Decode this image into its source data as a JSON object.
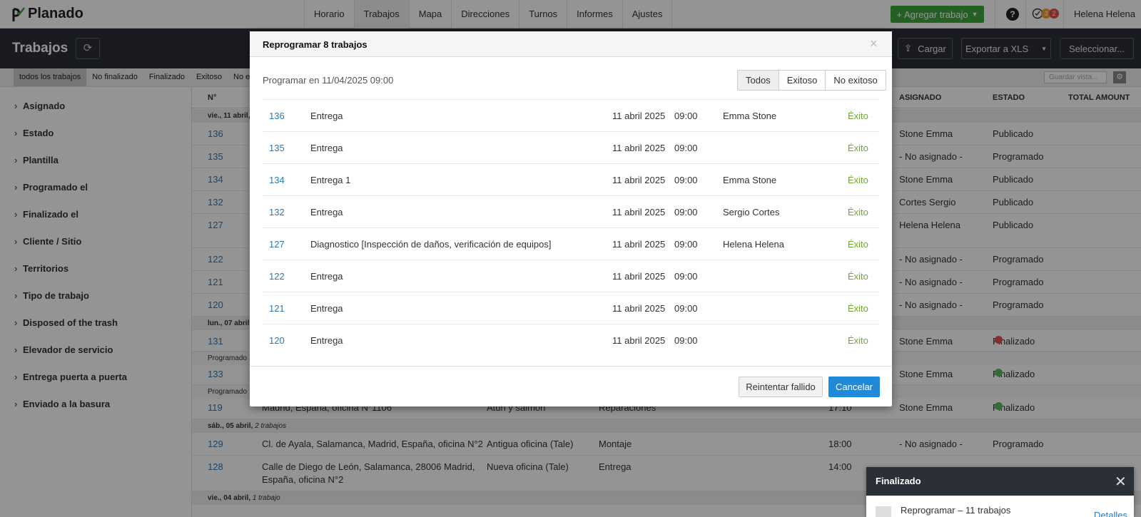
{
  "app": {
    "logo_text": "Planado"
  },
  "nav": {
    "items": [
      "Horario",
      "Trabajos",
      "Mapa",
      "Direcciones",
      "Turnos",
      "Informes",
      "Ajustes"
    ],
    "add_button": "+ Agregar trabajo",
    "help": "?",
    "badges": [
      "3",
      "2"
    ],
    "user": "Helena Helena"
  },
  "header": {
    "title": "Trabajos",
    "upload": "Cargar",
    "export": "Exportar a XLS",
    "select": "Seleccionar..."
  },
  "filters": {
    "tabs": [
      "todos los trabajos",
      "No finalizado",
      "Finalizado",
      "Exitoso",
      "No exi"
    ],
    "save_view_placeholder": "Guardar vista..."
  },
  "sidebar": {
    "items": [
      "Asignado",
      "Estado",
      "Plantilla",
      "Programado el",
      "Finalizado el",
      "Cliente / Sitio",
      "Territorios",
      "Tipo de trabajo",
      "Disposed of the trash",
      "Elevador de servicio",
      "Entrega puerta a puerta",
      "Enviado a la basura"
    ]
  },
  "table": {
    "columns": {
      "num": "N°",
      "assigned": "ASIGNADO",
      "status": "ESTADO",
      "amount": "TOTAL AMOUNT"
    },
    "groups": [
      {
        "label": "vie., 11 abril,",
        "count": ""
      },
      {
        "label": "lun., 07 abril,",
        "count": ""
      },
      {
        "label": "Programado",
        "count": ""
      },
      {
        "label": "Programado",
        "count": ""
      },
      {
        "label": "sáb., 05 abril,",
        "count": "2 trabajos"
      },
      {
        "label": "vie., 04 abril,",
        "count": "1 trabajo"
      }
    ],
    "rows": [
      {
        "num": "136",
        "assigned": "Stone Emma",
        "status": "Publicado"
      },
      {
        "num": "135",
        "assigned": "- No asignado -",
        "status": "Programado"
      },
      {
        "num": "134",
        "assigned": "Stone Emma",
        "status": "Publicado"
      },
      {
        "num": "132",
        "assigned": "Cortes Sergio",
        "status": "Publicado"
      },
      {
        "num": "127",
        "assigned": "Helena Helena",
        "status": "Publicado"
      },
      {
        "num": "122",
        "assigned": "- No asignado -",
        "status": "Programado"
      },
      {
        "num": "121",
        "assigned": "- No asignado -",
        "status": "Programado"
      },
      {
        "num": "120",
        "assigned": "- No asignado -",
        "status": "Programado"
      },
      {
        "num": "131",
        "assigned": "Stone Emma",
        "status": "Finalizado"
      },
      {
        "num": "133",
        "assigned": "Stone Emma",
        "status": "Finalizado"
      },
      {
        "num": "119",
        "address": "Madrid, España, oficina N°1106",
        "client": "Atún y salmón",
        "type": "Reparaciones",
        "time": "17:10",
        "assigned": "Stone Emma",
        "status": "Finalizado"
      },
      {
        "num": "129",
        "address": "Cl. de Ayala, Salamanca, Madrid, España, oficina N°2",
        "client": "Antigua oficina (Tale)",
        "type": "Montaje",
        "time": "18:00",
        "assigned": "- No asignado -",
        "status": "Programado"
      },
      {
        "num": "128",
        "address": "Calle de Diego de León, Salamanca, 28006 Madrid,",
        "address2": "España, oficina N°2",
        "client": "Nueva oficina (Tale)",
        "type": "Entrega",
        "time": "14:00"
      }
    ]
  },
  "modal": {
    "title": "Reprogramar 8 trabajos",
    "schedule_text": "Programar en 11/04/2025 09:00",
    "segments": [
      "Todos",
      "Exitoso",
      "No exitoso"
    ],
    "rows": [
      {
        "id": "136",
        "type": "Entrega",
        "date": "11 abril 2025",
        "time": "09:00",
        "assignee": "Emma Stone",
        "result": "Éxito"
      },
      {
        "id": "135",
        "type": "Entrega",
        "date": "11 abril 2025",
        "time": "09:00",
        "assignee": "",
        "result": "Éxito"
      },
      {
        "id": "134",
        "type": "Entrega 1",
        "date": "11 abril 2025",
        "time": "09:00",
        "assignee": "Emma Stone",
        "result": "Éxito"
      },
      {
        "id": "132",
        "type": "Entrega",
        "date": "11 abril 2025",
        "time": "09:00",
        "assignee": "Sergio Cortes",
        "result": "Éxito"
      },
      {
        "id": "127",
        "type": "Diagnostico [Inspección de daños, verificación de equipos]",
        "date": "11 abril 2025",
        "time": "09:00",
        "assignee": "Helena Helena",
        "result": "Éxito"
      },
      {
        "id": "122",
        "type": "Entrega",
        "date": "11 abril 2025",
        "time": "09:00",
        "assignee": "",
        "result": "Éxito"
      },
      {
        "id": "121",
        "type": "Entrega",
        "date": "11 abril 2025",
        "time": "09:00",
        "assignee": "",
        "result": "Éxito"
      },
      {
        "id": "120",
        "type": "Entrega",
        "date": "11 abril 2025",
        "time": "09:00",
        "assignee": "",
        "result": "Éxito"
      }
    ],
    "retry_button": "Reintentar fallido",
    "cancel_button": "Cancelar",
    "close": "×"
  },
  "toast": {
    "title": "Finalizado",
    "message": "Reprogramar – 11 trabajos",
    "details": "Detalles",
    "close": "✕"
  },
  "colors": {
    "accent": "#1f8ad9",
    "success": "#6fa82e",
    "add": "#3ea63a",
    "dark": "#2b3038",
    "fail": "#e05050",
    "ok": "#5cb85c"
  }
}
